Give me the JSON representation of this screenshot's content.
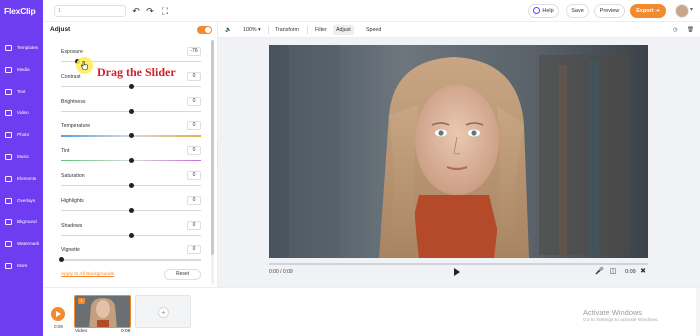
{
  "brand": {
    "name": "FlexClip"
  },
  "topbar": {
    "title_placeholder": "1",
    "help_label": "Help",
    "save_label": "Save",
    "preview_label": "Preview",
    "export_label": "Export ➔"
  },
  "sidebar": {
    "items": [
      {
        "label": "Templates",
        "icon": "templates-icon"
      },
      {
        "label": "Media",
        "icon": "media-icon"
      },
      {
        "label": "Text",
        "icon": "text-icon"
      },
      {
        "label": "Video",
        "icon": "video-icon"
      },
      {
        "label": "Photo",
        "icon": "photo-icon"
      },
      {
        "label": "Music",
        "icon": "music-icon"
      },
      {
        "label": "Elements",
        "icon": "elements-icon"
      },
      {
        "label": "Overlays",
        "icon": "overlays-icon"
      },
      {
        "label": "Bkground",
        "icon": "background-icon"
      },
      {
        "label": "Watermark",
        "icon": "watermark-icon"
      },
      {
        "label": "More",
        "icon": "more-icon"
      }
    ]
  },
  "adjust": {
    "title": "Adjust",
    "enabled": true,
    "rows": [
      {
        "label": "Exposure",
        "value": "-76",
        "level": 0.12
      },
      {
        "label": "Contrast",
        "value": "0",
        "level": 0.5
      },
      {
        "label": "Brightness",
        "value": "0",
        "level": 0.5
      },
      {
        "label": "Temperature",
        "value": "0",
        "level": 0.5
      },
      {
        "label": "Tint",
        "value": "0",
        "level": 0.5
      },
      {
        "label": "Saturation",
        "value": "0",
        "level": 0.5
      },
      {
        "label": "Highlights",
        "value": "0",
        "level": 0.5
      },
      {
        "label": "Shadows",
        "value": "0",
        "level": 0.5
      },
      {
        "label": "Vignette",
        "value": "0",
        "level": 0.0
      }
    ],
    "apply_all_label": "Apply to All Backgrounds",
    "reset_label": "Reset"
  },
  "annotation": {
    "text": "Drag the Slider"
  },
  "editor_toolbar": {
    "zoom": "100%",
    "items": [
      "Transform",
      "Filter",
      "Adjust",
      "Speed"
    ],
    "active": "Adjust"
  },
  "player": {
    "current_time": "0:00 / 0:09",
    "duration": "0:09",
    "progress": 0.0
  },
  "timeline": {
    "time": "0:09",
    "clip_label": "Video",
    "clip_duration": "0:09",
    "clip_badge": "1"
  },
  "watermark": {
    "title": "Activate Windows",
    "subtitle": "Go to Settings to activate Windows."
  },
  "colors": {
    "brand": "#6e3df2",
    "accent": "#f28a2e",
    "annotation": "#d21e2b"
  }
}
